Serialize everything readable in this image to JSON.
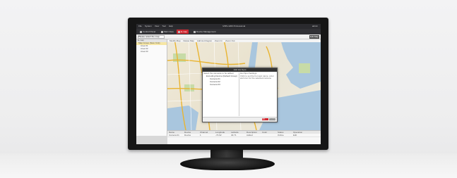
{
  "window": {
    "menus": [
      "File",
      "System",
      "View",
      "Tool",
      "Help"
    ],
    "app_title": "iVMS-4200 Professional",
    "user": "admin"
  },
  "tabs": [
    {
      "label": "Control Panel",
      "icon": "grid-icon"
    },
    {
      "label": "Main View",
      "icon": "camera-icon"
    },
    {
      "label": "E-map",
      "icon": "map-pin-icon",
      "active": true
    },
    {
      "label": "Device Management",
      "icon": "server-icon"
    }
  ],
  "toolbar": {
    "map_select": "Please select the map",
    "action_label": "Edit Map"
  },
  "left_panel": {
    "header": "E-map",
    "items": [
      {
        "label": "Map Group (New York)",
        "selected": true
      },
      {
        "label": "Area 01"
      },
      {
        "label": "Area 02"
      },
      {
        "label": "Area 03"
      }
    ]
  },
  "map_tools": [
    "Modify Map",
    "Delete Map",
    "Add Hot Region",
    "Zoom In",
    "Zoom Out"
  ],
  "dialog": {
    "title": "Add Hot Spot",
    "left_label": "Select the cameras to be added",
    "tree": [
      {
        "label": "Encoding Device (Default Group)",
        "level": 0
      },
      {
        "label": "Camera 01",
        "level": 1
      },
      {
        "label": "Camera 02",
        "level": 1
      },
      {
        "label": "Camera 03",
        "level": 1
      }
    ],
    "right_label": "Hot Spot Settings",
    "note": "Click to set the hot spot name, color and icon for the selected camera.",
    "ok": "OK",
    "cancel": "Cancel"
  },
  "table": {
    "columns": [
      "Name",
      "Device",
      "Channel",
      "Longitude",
      "Latitude",
      "Description",
      "Color",
      "Status",
      "Operation"
    ],
    "rows": [
      [
        "Camera 01",
        "Device",
        "1",
        "-73.92",
        "40.71",
        "Added",
        "",
        "Online",
        "Edit"
      ]
    ]
  },
  "colors": {
    "accent": "#d0262f",
    "titlebar": "#2a2a2e",
    "water": "#a9c6de",
    "park": "#c7dba7",
    "highway": "#e9b431"
  }
}
